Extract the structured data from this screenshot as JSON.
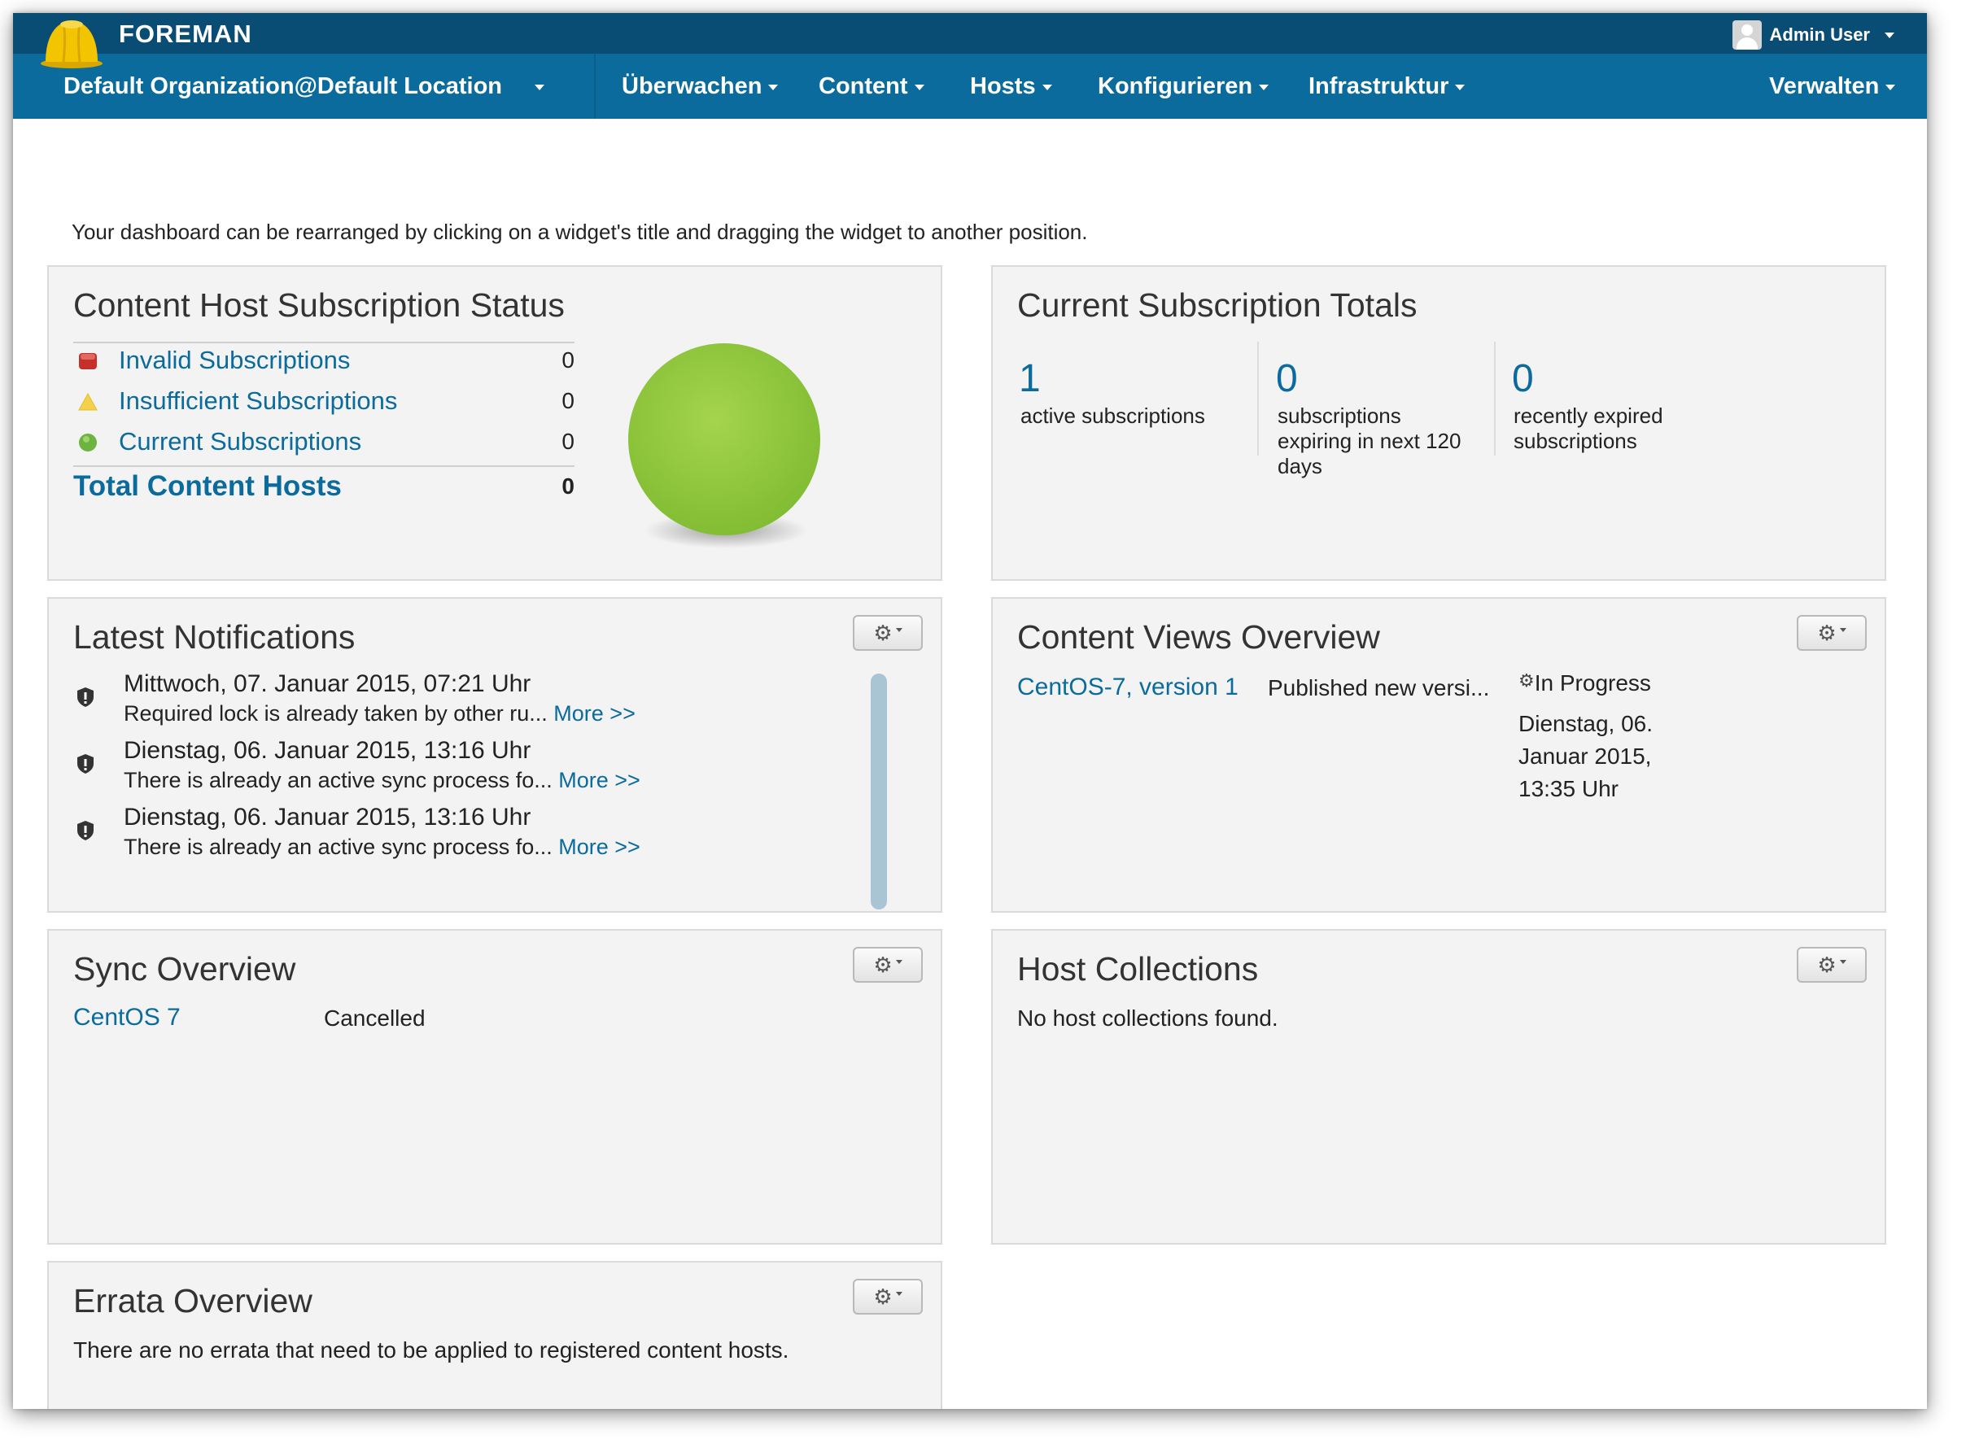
{
  "brand": "FOREMAN",
  "user": {
    "name": "Admin User"
  },
  "nav": {
    "org_location": "Default Organization@Default Location",
    "items": [
      "Überwachen",
      "Content",
      "Hosts",
      "Konfigurieren",
      "Infrastruktur"
    ],
    "admin": "Verwalten"
  },
  "intro": "Your dashboard can be rearranged by clicking on a widget's title and dragging the widget to another position.",
  "subscription_status": {
    "title": "Content Host Subscription Status",
    "rows": [
      {
        "label": "Invalid Subscriptions",
        "count": "0",
        "color": "#c6302a"
      },
      {
        "label": "Insufficient Subscriptions",
        "count": "0",
        "color": "#f1d24a"
      },
      {
        "label": "Current Subscriptions",
        "count": "0",
        "color": "#6cb33f"
      }
    ],
    "total_label": "Total Content Hosts",
    "total_count": "0",
    "pie_color": "#8dc63f"
  },
  "subscription_totals": {
    "title": "Current Subscription Totals",
    "items": [
      {
        "value": "1",
        "label_lines": [
          "active subscriptions"
        ]
      },
      {
        "value": "0",
        "label_lines": [
          "subscriptions",
          "expiring in next 120",
          "days"
        ]
      },
      {
        "value": "0",
        "label_lines": [
          "recently expired",
          "subscriptions"
        ]
      }
    ]
  },
  "notifications": {
    "title": "Latest Notifications",
    "items": [
      {
        "date": "Mittwoch, 07. Januar 2015, 07:21 Uhr",
        "message": "Required lock is already taken by other ru...",
        "more": "More >>"
      },
      {
        "date": "Dienstag, 06. Januar 2015, 13:16 Uhr",
        "message": "There is already an active sync process fo...",
        "more": "More >>"
      },
      {
        "date": "Dienstag, 06. Januar 2015, 13:16 Uhr",
        "message": "There is already an active sync process fo...",
        "more": "More >>"
      }
    ]
  },
  "content_views": {
    "title": "Content Views Overview",
    "row": {
      "name": "CentOS-7, version 1",
      "description": "Published new versi...",
      "status": "In Progress",
      "time_lines": [
        "Dienstag, 06.",
        "Januar 2015,",
        "13:35 Uhr"
      ]
    }
  },
  "sync": {
    "title": "Sync Overview",
    "row": {
      "product": "CentOS 7",
      "state": "Cancelled"
    }
  },
  "host_collections": {
    "title": "Host Collections",
    "empty": "No host collections found."
  },
  "errata": {
    "title": "Errata Overview",
    "empty": "There are no errata that need to be applied to registered content hosts."
  }
}
